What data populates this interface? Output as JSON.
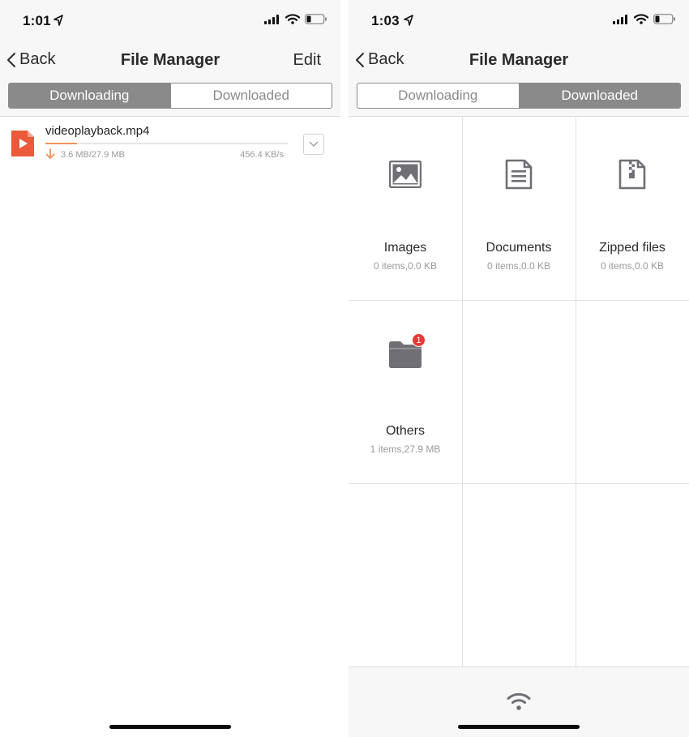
{
  "colors": {
    "accent_orange": "#f0935a",
    "segment_gray": "#8a8a8a",
    "badge_red": "#e53935",
    "icon_gray": "#6f6f75"
  },
  "left_screen": {
    "status": {
      "time": "1:01"
    },
    "nav": {
      "back_label": "Back",
      "title": "File Manager",
      "edit_label": "Edit"
    },
    "segments": {
      "downloading": "Downloading",
      "downloaded": "Downloaded",
      "active": "downloading"
    },
    "download": {
      "file_name": "videoplayback.mp4",
      "progress_text": "3.6 MB/27.9 MB",
      "progress_fraction": 0.129,
      "speed": "456.4 KB/s",
      "file_icon": "video-file-icon"
    }
  },
  "right_screen": {
    "status": {
      "time": "1:03"
    },
    "nav": {
      "back_label": "Back",
      "title": "File Manager"
    },
    "segments": {
      "downloading": "Downloading",
      "downloaded": "Downloaded",
      "active": "downloaded"
    },
    "categories": [
      {
        "name": "Images",
        "info": "0 items,0.0 KB",
        "icon": "image-icon"
      },
      {
        "name": "Documents",
        "info": "0 items,0.0 KB",
        "icon": "document-icon"
      },
      {
        "name": "Zipped files",
        "info": "0 items,0.0 KB",
        "icon": "zip-file-icon"
      },
      {
        "name": "Others",
        "info": "1 items,27.9 MB",
        "icon": "folder-icon",
        "badge": "1"
      }
    ],
    "bottom_bar": {
      "icon": "wifi-transfer-icon"
    }
  }
}
